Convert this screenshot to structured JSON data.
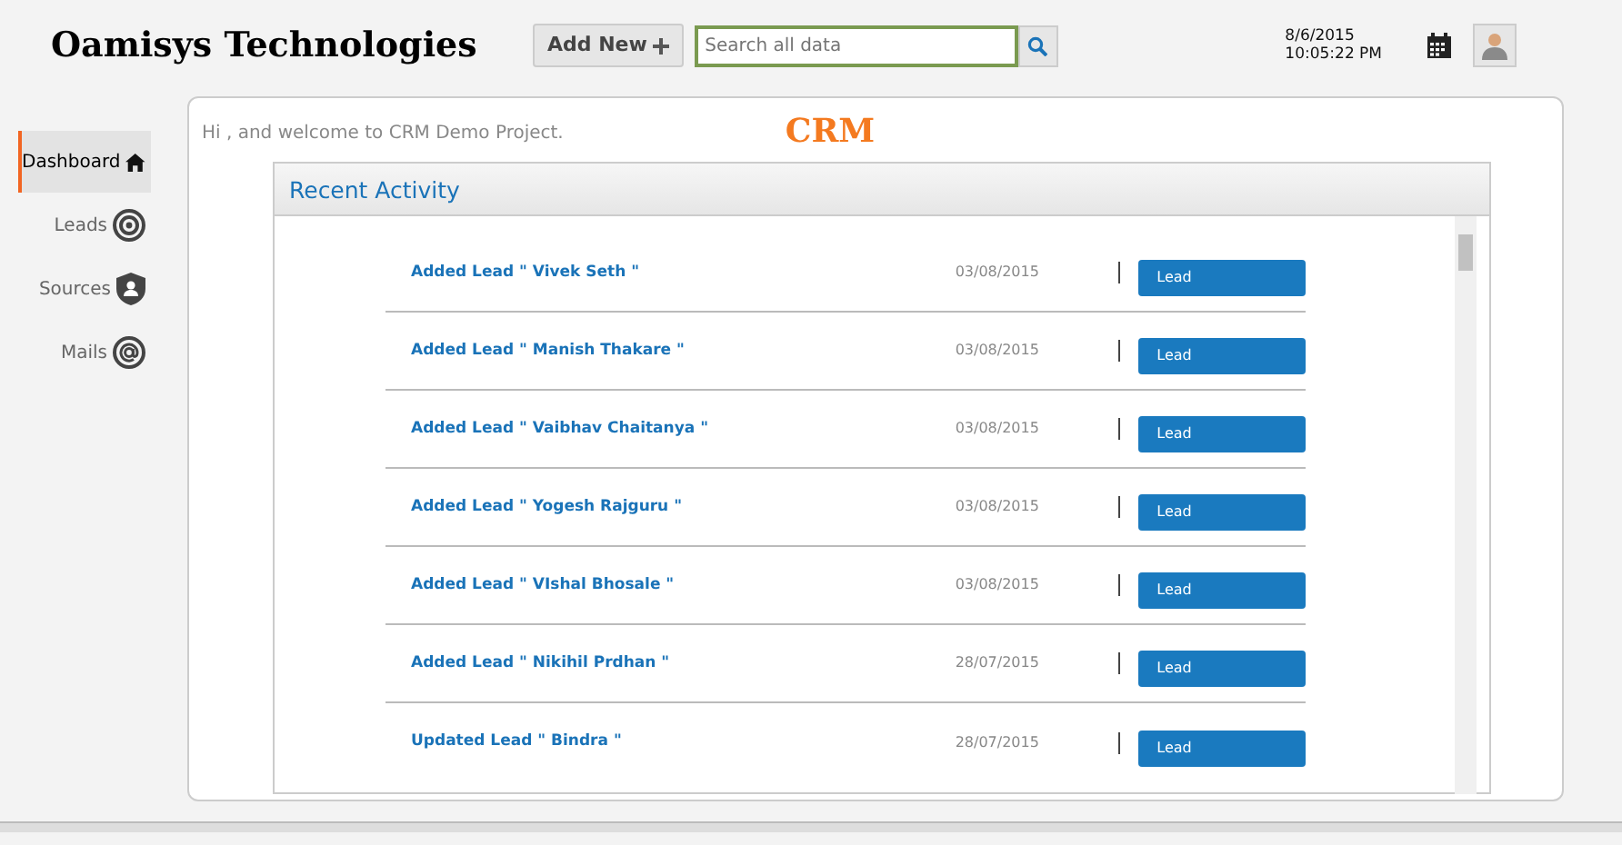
{
  "header": {
    "brand": "Oamisys Technologies",
    "add_button": "Add New",
    "search": {
      "placeholder": "Search all data"
    },
    "date": "8/6/2015",
    "time": "10:05:22 PM"
  },
  "sidebar": {
    "items": [
      {
        "label": "Dashboard",
        "kind": "home",
        "selected": true
      },
      {
        "label": "Leads",
        "kind": "target",
        "selected": false
      },
      {
        "label": "Sources",
        "kind": "shield",
        "selected": false
      },
      {
        "label": "Mails",
        "kind": "at",
        "selected": false
      }
    ]
  },
  "welcome": "Hi , and welcome to CRM Demo Project.",
  "app_title": "CRM",
  "recent_activity": {
    "title": "Recent Activity",
    "items": [
      {
        "text": "Added Lead \" Vivek Seth \"",
        "date": "03/08/2015",
        "badge": "Lead"
      },
      {
        "text": "Added Lead \" Manish Thakare \"",
        "date": "03/08/2015",
        "badge": "Lead"
      },
      {
        "text": "Added Lead \" Vaibhav Chaitanya \"",
        "date": "03/08/2015",
        "badge": "Lead"
      },
      {
        "text": "Added Lead \" Yogesh Rajguru \"",
        "date": "03/08/2015",
        "badge": "Lead"
      },
      {
        "text": "Added Lead \" VIshal Bhosale \"",
        "date": "03/08/2015",
        "badge": "Lead"
      },
      {
        "text": "Added Lead \" Nikihil Prdhan \"",
        "date": "28/07/2015",
        "badge": "Lead"
      },
      {
        "text": "Updated Lead \" Bindra \"",
        "date": "28/07/2015",
        "badge": "Lead"
      }
    ]
  }
}
